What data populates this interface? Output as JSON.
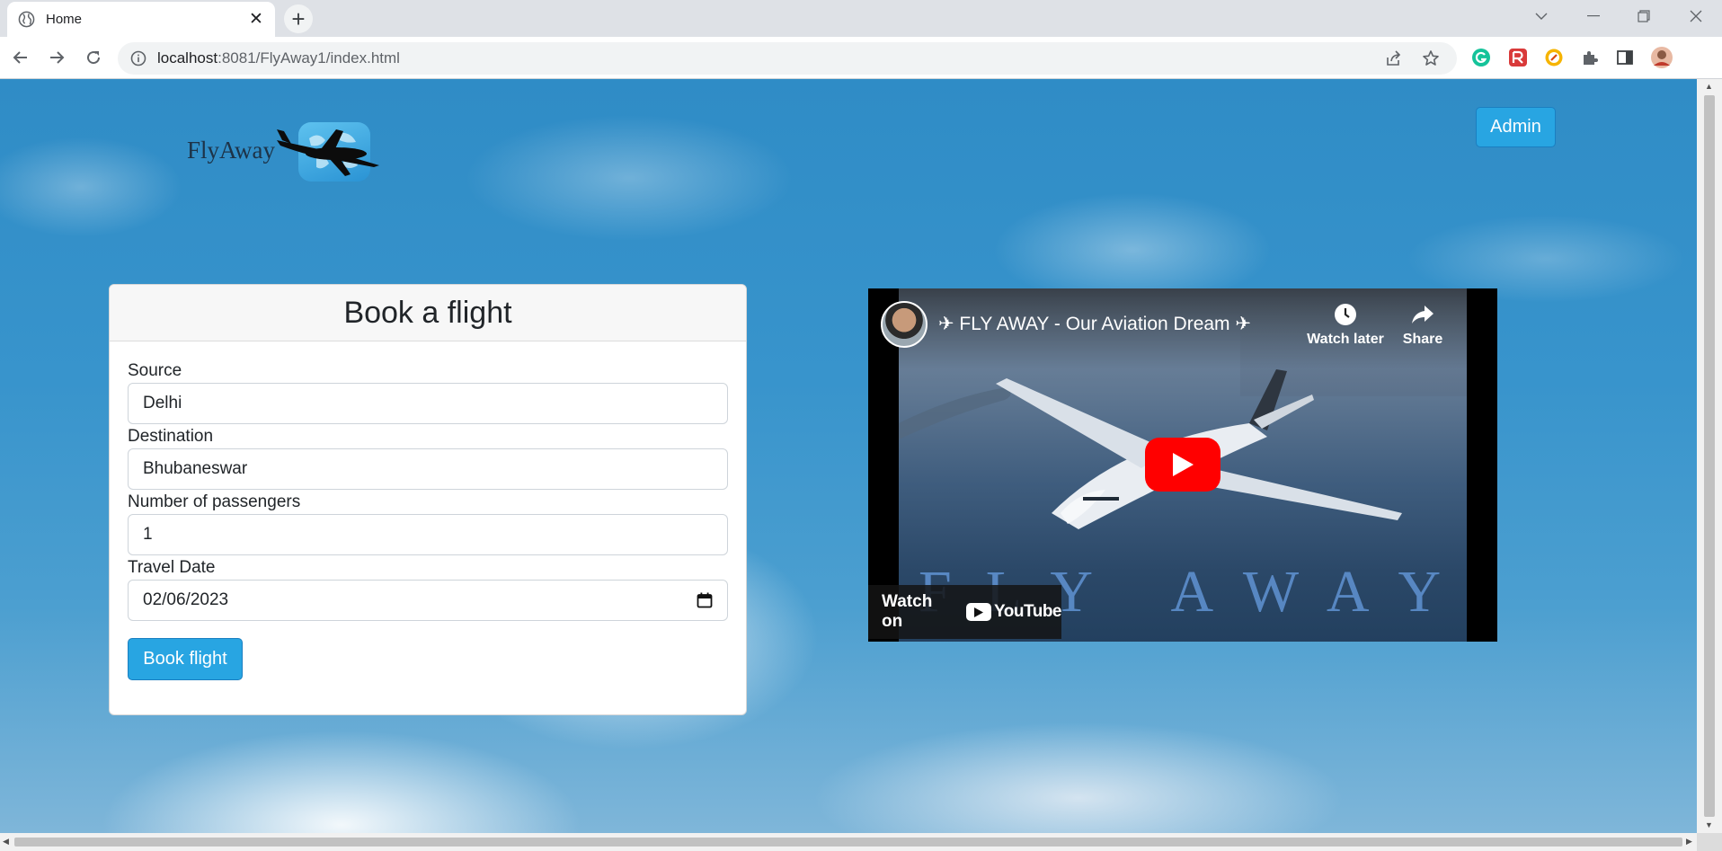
{
  "browser": {
    "tab_title": "Home",
    "tab_close": "✕",
    "new_tab": "+",
    "url_host": "localhost",
    "url_path": ":8081/FlyAway1/index.html"
  },
  "header": {
    "logo_text": "FlyAway",
    "admin_label": "Admin"
  },
  "booking_form": {
    "title": "Book a flight",
    "source_label": "Source",
    "source_value": "Delhi",
    "destination_label": "Destination",
    "destination_value": "Bhubaneswar",
    "passengers_label": "Number of passengers",
    "passengers_value": "1",
    "date_label": "Travel Date",
    "date_value": "02/06/2023",
    "submit_label": "Book flight"
  },
  "video": {
    "title": "✈ FLY AWAY - Our Aviation Dream ✈",
    "watch_later_label": "Watch later",
    "share_label": "Share",
    "watch_on_label": "Watch on",
    "youtube_label": "YouTube",
    "overlay_text": "FLY AWAY"
  },
  "colors": {
    "accent": "#28a5e2",
    "sky": "#2f8cc6",
    "youtube_red": "#ff0000"
  }
}
